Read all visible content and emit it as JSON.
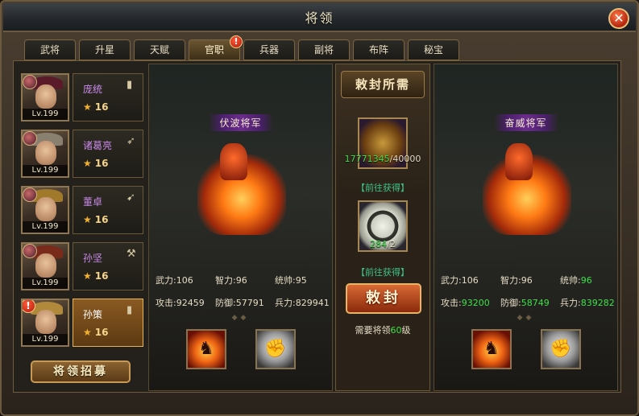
{
  "window": {
    "title": "将领"
  },
  "tabs": [
    {
      "label": "武将"
    },
    {
      "label": "升星"
    },
    {
      "label": "天赋"
    },
    {
      "label": "官职",
      "badge": "!"
    },
    {
      "label": "兵器"
    },
    {
      "label": "副将"
    },
    {
      "label": "布阵"
    },
    {
      "label": "秘宝"
    }
  ],
  "generals": [
    {
      "name": "庞统",
      "stars": "16",
      "level": "Lv.199",
      "name_color": "#c98ae8"
    },
    {
      "name": "诸葛亮",
      "stars": "16",
      "level": "Lv.199",
      "name_color": "#c98ae8"
    },
    {
      "name": "董卓",
      "stars": "16",
      "level": "Lv.199",
      "name_color": "#c98ae8"
    },
    {
      "name": "孙坚",
      "stars": "16",
      "level": "Lv.199",
      "name_color": "#c98ae8"
    },
    {
      "name": "孙策",
      "stars": "16",
      "level": "Lv.199",
      "name_color": "#ffffff",
      "selected": true,
      "alert": "!"
    }
  ],
  "recruit_button": "将领招募",
  "current": {
    "rank": "伏波将军",
    "wuli_label": "武力:",
    "wuli": "106",
    "zhili_label": "智力:",
    "zhili": "96",
    "tongshuai_label": "统帅:",
    "tongshuai": "95",
    "gongji_label": "攻击:",
    "gongji": "92459",
    "fangyu_label": "防御:",
    "fangyu": "57791",
    "bingli_label": "兵力:",
    "bingli": "829941"
  },
  "next": {
    "rank": "奋威将军",
    "wuli_label": "武力:",
    "wuli": "106",
    "zhili_label": "智力:",
    "zhili": "96",
    "tongshuai_label": "统帅:",
    "tongshuai": "96",
    "gongji_label": "攻击:",
    "gongji": "93200",
    "fangyu_label": "防御:",
    "fangyu": "58749",
    "bingli_label": "兵力:",
    "bingli": "839282"
  },
  "requirements": {
    "title": "敕封所需",
    "item1_have": "17771345",
    "item1_need": "/40000",
    "item2_have": "284",
    "item2_need": "/2",
    "goto_link": "【前往获得】",
    "confer_button": "敕封",
    "req_prefix": "需要将领",
    "req_level": "60",
    "req_suffix": "级"
  },
  "colors": {
    "accent_green": "#3fe04a",
    "gold": "#e6b45a"
  }
}
